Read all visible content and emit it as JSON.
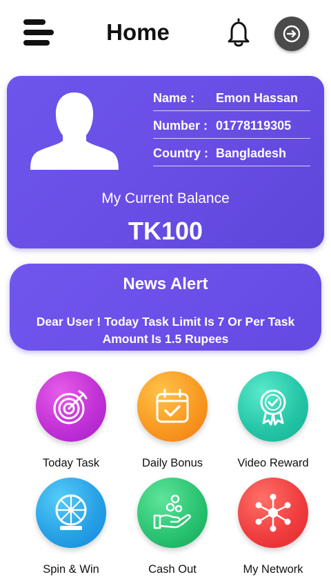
{
  "header": {
    "title": "Home",
    "menu_icon": "hamburger-menu-icon",
    "notification_icon": "bell-icon",
    "logout_icon": "logout-icon"
  },
  "profile": {
    "name_label": "Name :",
    "name_value": "Emon Hassan",
    "number_label": "Number :",
    "number_value": "01778119305",
    "country_label": "Country :",
    "country_value": "Bangladesh",
    "balance_label": "My Current Balance",
    "balance_value": "TK100"
  },
  "news": {
    "title": "News Alert",
    "message": "Dear User ! Today Task Limit Is 7 Or Per Task Amount Is 1.5 Rupees"
  },
  "features": [
    {
      "label": "Today Task",
      "icon": "target-icon",
      "color_from": "#e14ee4",
      "color_to": "#a51ec9"
    },
    {
      "label": "Daily Bonus",
      "icon": "calendar-icon",
      "color_from": "#ffb43a",
      "color_to": "#f07b12"
    },
    {
      "label": "Video Reward",
      "icon": "award-badge-icon",
      "color_from": "#4fe4c6",
      "color_to": "#13b095"
    },
    {
      "label": "Spin & Win",
      "icon": "wheel-icon",
      "color_from": "#49c4f5",
      "color_to": "#1487d8"
    },
    {
      "label": "Cash Out",
      "icon": "cash-hand-icon",
      "color_from": "#4edb8e",
      "color_to": "#12a85a"
    },
    {
      "label": "My Network",
      "icon": "network-icon",
      "color_from": "#ff6560",
      "color_to": "#e0262c"
    }
  ],
  "colors": {
    "card_purple": "#6a4fe6",
    "text_dark": "#111111"
  }
}
